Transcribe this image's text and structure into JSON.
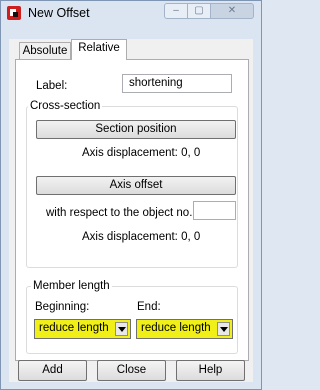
{
  "window": {
    "title": "New Offset",
    "min_glyph": "–",
    "max_glyph": "▢",
    "close_glyph": "✕"
  },
  "tabs": {
    "absolute": "Absolute",
    "relative": "Relative"
  },
  "label_field": {
    "label": "Label:",
    "value": "shortening"
  },
  "cross_section": {
    "legend": "Cross-section",
    "section_position_button": "Section position",
    "axis_displacement_1": "Axis displacement:  0, 0",
    "axis_offset_button": "Axis offset",
    "object_no_label": "with respect to the object no.:",
    "object_no_value": "",
    "axis_displacement_2": "Axis displacement:  0, 0"
  },
  "member_length": {
    "legend": "Member length",
    "beginning_label": "Beginning:",
    "beginning_value": "reduce length",
    "end_label": "End:",
    "end_value": "reduce length",
    "highlight_color": "#f0f018"
  },
  "footer": {
    "add": "Add",
    "close": "Close",
    "help": "Help"
  }
}
